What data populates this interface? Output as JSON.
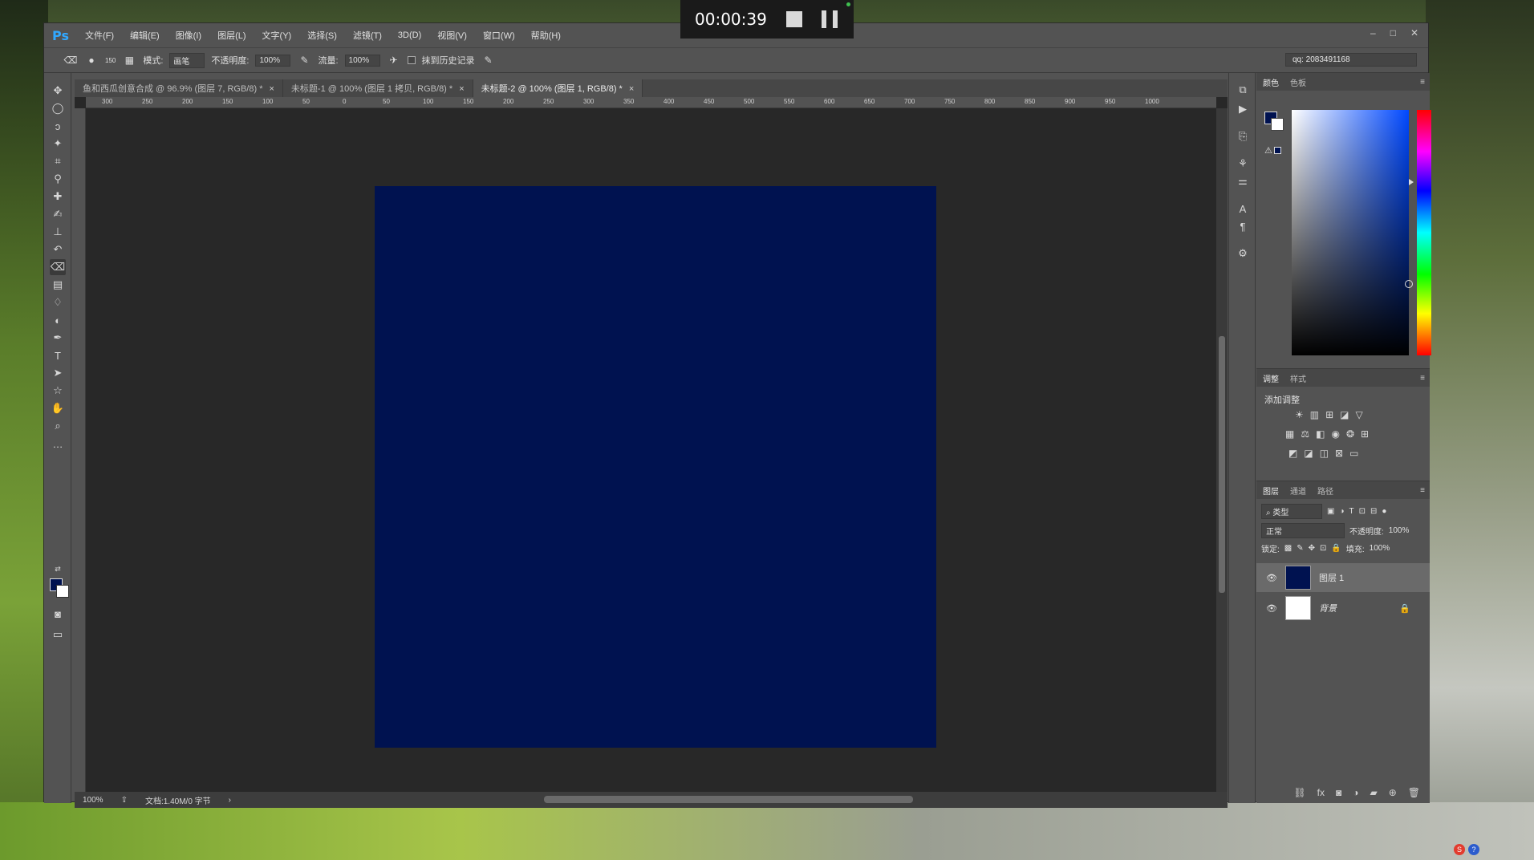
{
  "app": {
    "logo": "Ps",
    "menu": [
      "文件(F)",
      "编辑(E)",
      "图像(I)",
      "图层(L)",
      "文字(Y)",
      "选择(S)",
      "滤镜(T)",
      "3D(D)",
      "视图(V)",
      "窗口(W)",
      "帮助(H)"
    ],
    "window_controls": [
      "–",
      "□",
      "✕"
    ]
  },
  "recorder": {
    "time": "00:00:39"
  },
  "options": {
    "brush_size": "150",
    "mode_label": "模式:",
    "mode_value": "画笔",
    "opacity_label": "不透明度:",
    "opacity_value": "100%",
    "flow_label": "流量:",
    "flow_value": "100%",
    "history_label": "抹到历史记录",
    "user_box": "qq: 2083491168"
  },
  "tabs": [
    {
      "label": "鱼和西瓜创意合成 @ 96.9% (图层 7, RGB/8) *",
      "active": false
    },
    {
      "label": "未标题-1 @ 100% (图层 1 拷贝, RGB/8) *",
      "active": false
    },
    {
      "label": "未标题-2 @ 100% (图层 1, RGB/8) *",
      "active": true
    }
  ],
  "ruler_ticks": [
    "300",
    "250",
    "200",
    "150",
    "100",
    "50",
    "0",
    "50",
    "100",
    "150",
    "200",
    "250",
    "300",
    "350",
    "400",
    "450",
    "500",
    "550",
    "600",
    "650",
    "700",
    "750",
    "800",
    "850",
    "900",
    "950",
    "1000"
  ],
  "status": {
    "zoom": "100%",
    "doc": "文档:1.40M/0 字节"
  },
  "colors": {
    "fg": "#001250",
    "bg": "#ffffff",
    "canvas": "#001250"
  },
  "color_panel": {
    "tab_color": "颜色",
    "tab_swatches": "色板"
  },
  "adjust_panel": {
    "tab_adjust": "调整",
    "tab_style": "样式",
    "title": "添加调整"
  },
  "layers_panel": {
    "tab_layers": "图层",
    "tab_channels": "通道",
    "tab_paths": "路径",
    "filter_label": "类型",
    "blend_mode": "正常",
    "opacity_label": "不透明度:",
    "opacity_value": "100%",
    "lock_label": "锁定:",
    "fill_label": "填充:",
    "fill_value": "100%",
    "layers": [
      {
        "name": "图层 1",
        "selected": true,
        "thumb": "#001250"
      },
      {
        "name": "背景",
        "selected": false,
        "thumb": "#ffffff",
        "locked": true
      }
    ]
  }
}
